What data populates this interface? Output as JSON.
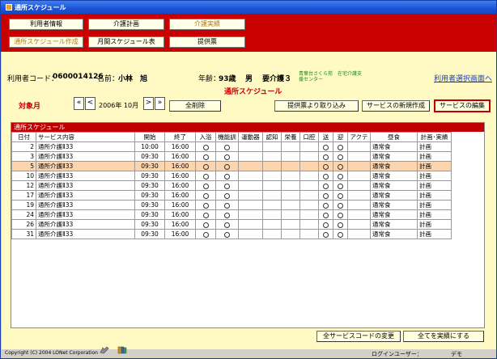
{
  "window": {
    "title": "通所スケジュール"
  },
  "nav": {
    "row1": [
      "利用者情報",
      "介護計画",
      "介護実績"
    ],
    "row2": [
      "通所スケジュール作成",
      "月間スケジュール表",
      "提供票"
    ],
    "active_row1": 2,
    "active_row2": 0
  },
  "client": {
    "code_label": "利用者コード：",
    "code": "0600014126",
    "name_label": "名前：",
    "name": "小林　旭",
    "age_label": "年齢：",
    "age": "93歳",
    "gender": "男",
    "care_level": "要介護３",
    "facility_line1": "青葉台さくら苑　在宅介護支",
    "facility_line2": "援センター",
    "select_link": "利用者選択画面へ"
  },
  "schedule": {
    "title": "通所スケジュール",
    "target_month_label": "対象月",
    "month_display": "2006年 10月",
    "delete_all": "全削除",
    "import_button": "提供票より取り込み",
    "new_service_button": "サービスの新規作成",
    "edit_service_button": "サービスの編集"
  },
  "grid": {
    "section_title": "通所スケジュール",
    "headers": [
      "日付",
      "サービス内容",
      "開始",
      "終了",
      "入浴",
      "機能訓",
      "運動器",
      "認知",
      "栄養",
      "口腔",
      "送",
      "迎",
      "アクテ",
      "昼食",
      "計画･実績"
    ],
    "rows": [
      {
        "day": "2",
        "service": "通所介護Ⅱ33",
        "start": "10:00",
        "end": "16:00",
        "bath": "○",
        "func": "○",
        "send": "○",
        "pick": "○",
        "lunch": "通常食",
        "plan": "計画"
      },
      {
        "day": "3",
        "service": "通所介護Ⅱ33",
        "start": "09:30",
        "end": "16:00",
        "bath": "○",
        "func": "○",
        "send": "○",
        "pick": "○",
        "lunch": "通常食",
        "plan": "計画"
      },
      {
        "day": "5",
        "service": "通所介護Ⅱ33",
        "start": "09:30",
        "end": "16:00",
        "bath": "○",
        "func": "○",
        "send": "○",
        "pick": "○",
        "lunch": "通常食",
        "plan": "計画"
      },
      {
        "day": "10",
        "service": "通所介護Ⅱ33",
        "start": "09:30",
        "end": "16:00",
        "bath": "○",
        "func": "○",
        "send": "○",
        "pick": "○",
        "lunch": "通常食",
        "plan": "計画"
      },
      {
        "day": "12",
        "service": "通所介護Ⅱ33",
        "start": "09:30",
        "end": "16:00",
        "bath": "○",
        "func": "○",
        "send": "○",
        "pick": "○",
        "lunch": "通常食",
        "plan": "計画"
      },
      {
        "day": "17",
        "service": "通所介護Ⅱ33",
        "start": "09:30",
        "end": "16:00",
        "bath": "○",
        "func": "○",
        "send": "○",
        "pick": "○",
        "lunch": "通常食",
        "plan": "計画"
      },
      {
        "day": "19",
        "service": "通所介護Ⅱ33",
        "start": "09:30",
        "end": "16:00",
        "bath": "○",
        "func": "○",
        "send": "○",
        "pick": "○",
        "lunch": "通常食",
        "plan": "計画"
      },
      {
        "day": "24",
        "service": "通所介護Ⅱ33",
        "start": "09:30",
        "end": "16:00",
        "bath": "○",
        "func": "○",
        "send": "○",
        "pick": "○",
        "lunch": "通常食",
        "plan": "計画"
      },
      {
        "day": "26",
        "service": "通所介護Ⅱ33",
        "start": "09:30",
        "end": "16:00",
        "bath": "○",
        "func": "○",
        "send": "○",
        "pick": "○",
        "lunch": "通常食",
        "plan": "計画"
      },
      {
        "day": "31",
        "service": "通所介護Ⅱ33",
        "start": "09:30",
        "end": "16:00",
        "bath": "○",
        "func": "○",
        "send": "○",
        "pick": "○",
        "lunch": "通常食",
        "plan": "計画"
      }
    ],
    "selected_row": 2
  },
  "bottom": {
    "change_all_codes": "全サービスコードの変更",
    "make_all_actual": "全てを実績にする"
  },
  "footer": {
    "copyright": "Copyright (C) 2004 LONet Corporation",
    "login_label": "ログインユーザー：",
    "login_user": "デモ"
  },
  "icons": {
    "app": "app-icon",
    "phone": "phone-icon",
    "book": "book-icon"
  },
  "colors": {
    "header_red": "#c80000",
    "content_bg": "#fff9c4",
    "selected_row": "#fbd5b0",
    "link_blue": "#1a40c0",
    "title_red": "#d00000"
  }
}
